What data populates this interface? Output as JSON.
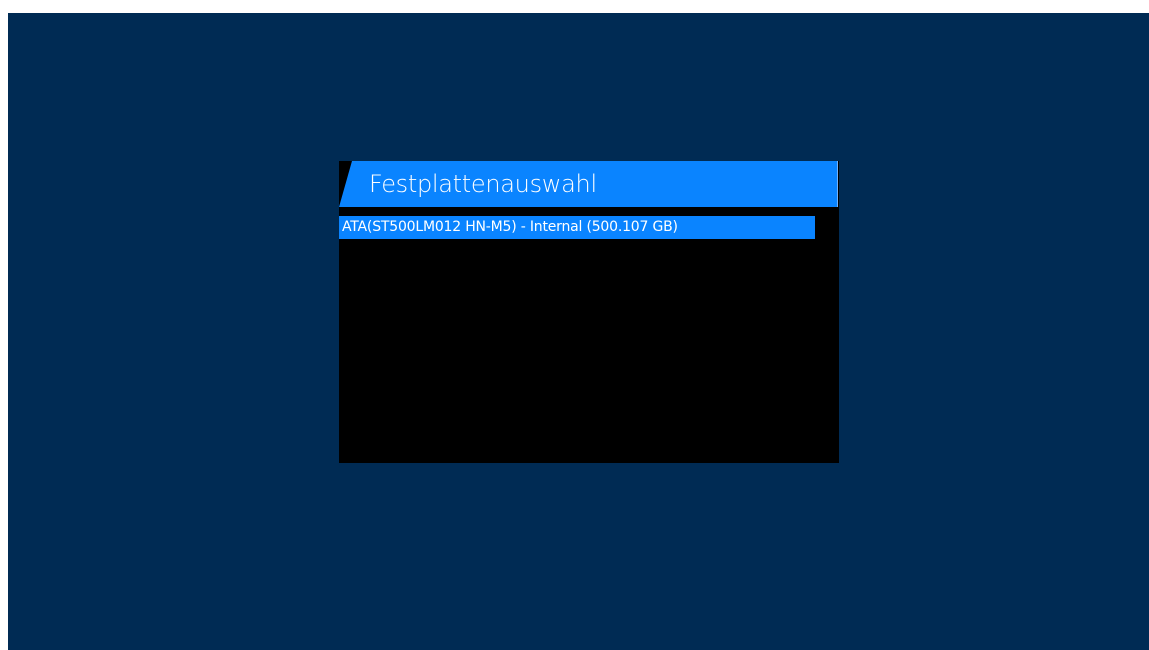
{
  "dialog": {
    "title": "Festplattenauswahl",
    "disks": [
      {
        "label": "ATA(ST500LM012 HN-M5) - Internal (500.107 GB)",
        "selected": true
      }
    ]
  },
  "colors": {
    "background": "#002b54",
    "accent": "#0a84ff",
    "panel": "#000000",
    "text": "#ffffff"
  }
}
